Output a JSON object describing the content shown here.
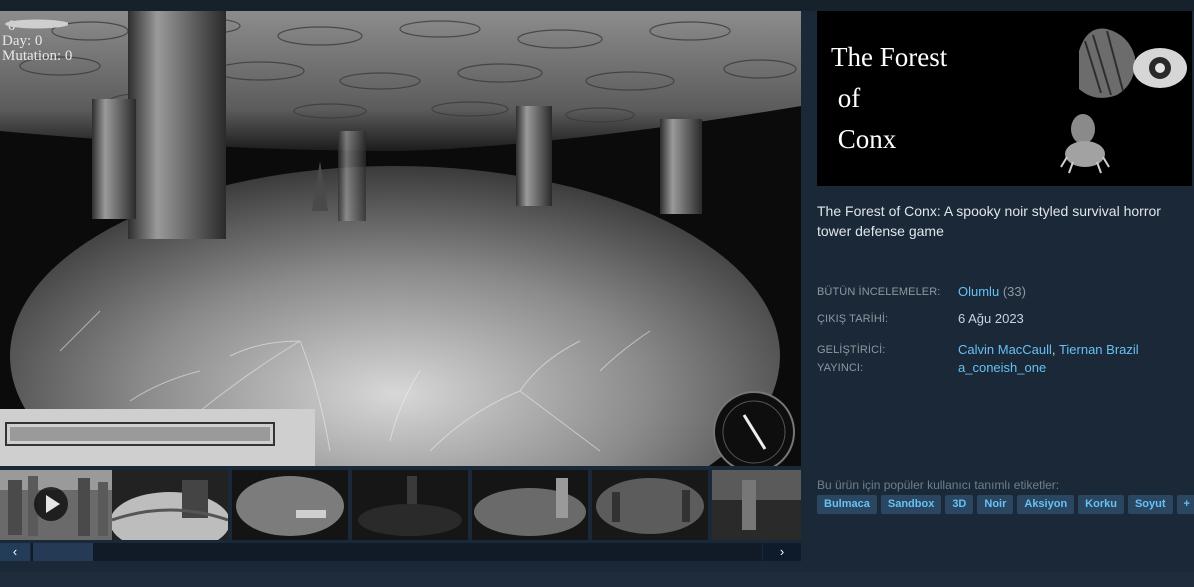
{
  "hud": {
    "leaf_value": "0",
    "day_label": "Day: 0",
    "mutation_label": "Mutation: 0"
  },
  "gallery": {
    "thumbnail_count": 7,
    "active_index": 0,
    "prev_glyph": "‹",
    "next_glyph": "›"
  },
  "capsule": {
    "title_lines": [
      "The Forest",
      " of",
      " Conx"
    ]
  },
  "description": "The Forest of Conx: A spooky noir styled survival horror tower defense game",
  "reviews": {
    "label": "BÜTÜN İNCELEMELER:",
    "summary": "Olumlu",
    "count": "(33)"
  },
  "release": {
    "label": "ÇIKIŞ TARİHİ:",
    "date": "6 Ağu 2023"
  },
  "developer": {
    "label": "GELİŞTİRİCİ:",
    "names": [
      "Calvin MacCaull",
      "Tiernan Brazil"
    ],
    "separator": ","
  },
  "publisher": {
    "label": "YAYINCI:",
    "name": "a_coneish_one"
  },
  "tags": {
    "label": "Bu ürün için popüler kullanıcı tanımlı etiketler:",
    "items": [
      "Bulmaca",
      "Sandbox",
      "3D",
      "Noir",
      "Aksiyon",
      "Korku",
      "Soyut",
      "+"
    ]
  },
  "colors": {
    "background": "#1b2838",
    "link": "#66c0f4",
    "tag_bg": "#2a4661",
    "tag_text": "#67c1f5",
    "label": "#8f98a0"
  },
  "icons": {
    "play": "play-icon",
    "compass": "compass-icon",
    "prev": "chevron-left-icon",
    "next": "chevron-right-icon"
  }
}
